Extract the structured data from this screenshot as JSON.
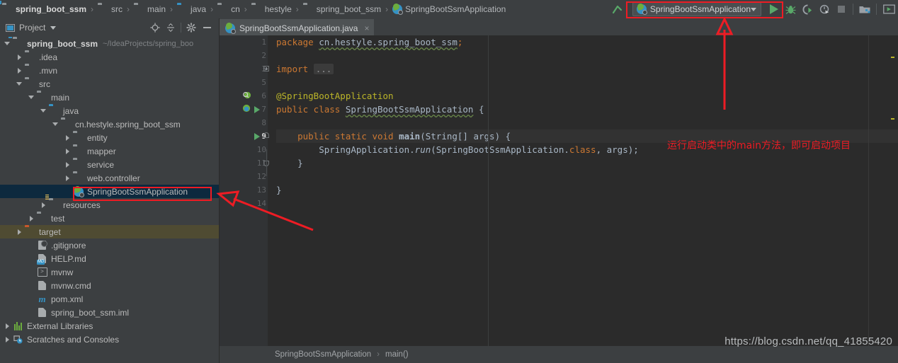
{
  "navbar": {
    "crumbs": [
      {
        "label": "spring_boot_ssm",
        "icon": "module-icon"
      },
      {
        "label": "src",
        "icon": "folder-icon"
      },
      {
        "label": "main",
        "icon": "folder-icon"
      },
      {
        "label": "java",
        "icon": "source-root-folder-icon"
      },
      {
        "label": "cn",
        "icon": "package-icon"
      },
      {
        "label": "hestyle",
        "icon": "package-icon"
      },
      {
        "label": "spring_boot_ssm",
        "icon": "package-icon"
      },
      {
        "label": "SpringBootSsmApplication",
        "icon": "spring-boot-class-icon"
      }
    ],
    "separator": "›"
  },
  "toolbar": {
    "update_icon": "update-project-icon",
    "run_config_name": "SpringBootSsmApplication",
    "run_config_icon": "spring-boot-run-config-icon",
    "run_button": "run-icon",
    "debug_button": "debug-icon",
    "run_coverage_button": "run-with-coverage-icon",
    "profiler_button": "profiler-icon",
    "stop_button": "stop-icon",
    "build_button": "build-project-icon",
    "run_anything_button": "run-anything-icon",
    "accent_green": "#59a869",
    "annotation_red": "#ee1c24"
  },
  "project_panel": {
    "title": "Project",
    "title_icon": "project-view-icon",
    "tools": [
      {
        "name": "select-opened-file-icon"
      },
      {
        "name": "collapse-all-icon"
      },
      {
        "name": "gear-icon"
      },
      {
        "name": "hide-icon"
      }
    ],
    "tree": [
      {
        "label": "spring_boot_ssm",
        "path": "~/IdeaProjects/spring_boo",
        "indent": 0,
        "arrow": "open",
        "icon": "module-icon",
        "bold": true,
        "state": "normal"
      },
      {
        "label": ".idea",
        "path": "",
        "indent": 1,
        "arrow": "closed",
        "icon": "folder-icon",
        "bold": false,
        "state": "normal"
      },
      {
        "label": ".mvn",
        "path": "",
        "indent": 1,
        "arrow": "closed",
        "icon": "folder-icon",
        "bold": false,
        "state": "normal"
      },
      {
        "label": "src",
        "path": "",
        "indent": 1,
        "arrow": "open",
        "icon": "folder-icon",
        "bold": false,
        "state": "normal"
      },
      {
        "label": "main",
        "path": "",
        "indent": 2,
        "arrow": "open",
        "icon": "folder-icon",
        "bold": false,
        "state": "normal"
      },
      {
        "label": "java",
        "path": "",
        "indent": 3,
        "arrow": "open",
        "icon": "source-root-folder-icon",
        "bold": false,
        "state": "normal"
      },
      {
        "label": "cn.hestyle.spring_boot_ssm",
        "path": "",
        "indent": 4,
        "arrow": "open",
        "icon": "package-icon",
        "bold": false,
        "state": "normal"
      },
      {
        "label": "entity",
        "path": "",
        "indent": 5,
        "arrow": "closed",
        "icon": "package-icon",
        "bold": false,
        "state": "normal"
      },
      {
        "label": "mapper",
        "path": "",
        "indent": 5,
        "arrow": "closed",
        "icon": "package-icon",
        "bold": false,
        "state": "normal"
      },
      {
        "label": "service",
        "path": "",
        "indent": 5,
        "arrow": "closed",
        "icon": "package-icon",
        "bold": false,
        "state": "normal"
      },
      {
        "label": "web.controller",
        "path": "",
        "indent": 5,
        "arrow": "closed",
        "icon": "package-icon",
        "bold": false,
        "state": "normal"
      },
      {
        "label": "SpringBootSsmApplication",
        "path": "",
        "indent": 5,
        "arrow": "none",
        "icon": "spring-boot-class-icon",
        "bold": false,
        "state": "selected"
      },
      {
        "label": "resources",
        "path": "",
        "indent": 3,
        "arrow": "closed",
        "icon": "resource-root-folder-icon",
        "bold": false,
        "state": "normal"
      },
      {
        "label": "test",
        "path": "",
        "indent": 2,
        "arrow": "closed",
        "icon": "folder-icon",
        "bold": false,
        "state": "normal"
      },
      {
        "label": "target",
        "path": "",
        "indent": 1,
        "arrow": "closed",
        "icon": "excluded-folder-icon",
        "bold": false,
        "state": "excluded"
      },
      {
        "label": ".gitignore",
        "path": "",
        "indent": 2,
        "arrow": "none",
        "icon": "gitignore-file-icon",
        "bold": false,
        "state": "normal"
      },
      {
        "label": "HELP.md",
        "path": "",
        "indent": 2,
        "arrow": "none",
        "icon": "markdown-file-icon",
        "bold": false,
        "state": "normal"
      },
      {
        "label": "mvnw",
        "path": "",
        "indent": 2,
        "arrow": "none",
        "icon": "shell-script-icon",
        "bold": false,
        "state": "normal"
      },
      {
        "label": "mvnw.cmd",
        "path": "",
        "indent": 2,
        "arrow": "none",
        "icon": "cmd-file-icon",
        "bold": false,
        "state": "normal"
      },
      {
        "label": "pom.xml",
        "path": "",
        "indent": 2,
        "arrow": "none",
        "icon": "maven-file-icon",
        "bold": false,
        "state": "normal"
      },
      {
        "label": "spring_boot_ssm.iml",
        "path": "",
        "indent": 2,
        "arrow": "none",
        "icon": "iml-file-icon",
        "bold": false,
        "state": "normal"
      },
      {
        "label": "External Libraries",
        "path": "",
        "indent": 0,
        "arrow": "closed",
        "icon": "libraries-icon",
        "bold": false,
        "state": "normal"
      },
      {
        "label": "Scratches and Consoles",
        "path": "",
        "indent": 0,
        "arrow": "closed",
        "icon": "scratches-icon",
        "bold": false,
        "state": "normal"
      }
    ]
  },
  "editor": {
    "tab": {
      "label": "SpringBootSsmApplication.java",
      "icon": "spring-boot-class-icon",
      "close": "×"
    },
    "current_line": 9,
    "lines": [
      {
        "num": "1",
        "gutter": "",
        "fold": "",
        "html": "<span class='kw'>package</span> <span class='squig'>cn.hestyle.spring_boot_ssm</span><span class='kw'>;</span>"
      },
      {
        "num": "2",
        "gutter": "",
        "fold": "",
        "html": ""
      },
      {
        "num": "3",
        "gutter": "",
        "fold": "plus",
        "html": "<span class='kw'>import</span> <span class='foldph'>...</span>"
      },
      {
        "num": "5",
        "gutter": "",
        "fold": "",
        "html": ""
      },
      {
        "num": "6",
        "gutter": "bean",
        "fold": "",
        "html": "<span class='ann'>@SpringBootApplication</span>"
      },
      {
        "num": "7",
        "gutter": "spring-run",
        "fold": "",
        "html": "<span class='kw'>public class</span> <span class='squig'>SpringBootSsmApplication</span> {"
      },
      {
        "num": "8",
        "gutter": "",
        "fold": "",
        "html": ""
      },
      {
        "num": "9",
        "gutter": "run",
        "fold": "start",
        "html": "    <span class='kw'>public static void</span> <span class='mthb'>main</span>(String[] args) {"
      },
      {
        "num": "10",
        "gutter": "",
        "fold": "",
        "html": "        SpringApplication.<span class='ital'>run</span>(SpringBootSsmApplication.<span class='kw'>class</span>, args);"
      },
      {
        "num": "11",
        "gutter": "",
        "fold": "end",
        "html": "    }"
      },
      {
        "num": "12",
        "gutter": "",
        "fold": "",
        "html": ""
      },
      {
        "num": "13",
        "gutter": "",
        "fold": "",
        "html": "}"
      },
      {
        "num": "14",
        "gutter": "",
        "fold": "",
        "html": ""
      }
    ],
    "breadcrumb": {
      "class": "SpringBootSsmApplication",
      "separator": "›",
      "method": "main()"
    }
  },
  "annotations": {
    "note_text": "运行启动类中的main方法，即可启动项目",
    "color": "#ee1c24",
    "boxes": [
      {
        "name": "run-config-highlight-box"
      },
      {
        "name": "application-class-highlight-box"
      }
    ],
    "arrows": [
      {
        "name": "arrow-up-to-run-config"
      },
      {
        "name": "arrow-to-application-class"
      }
    ]
  },
  "watermark": "https://blog.csdn.net/qq_41855420"
}
